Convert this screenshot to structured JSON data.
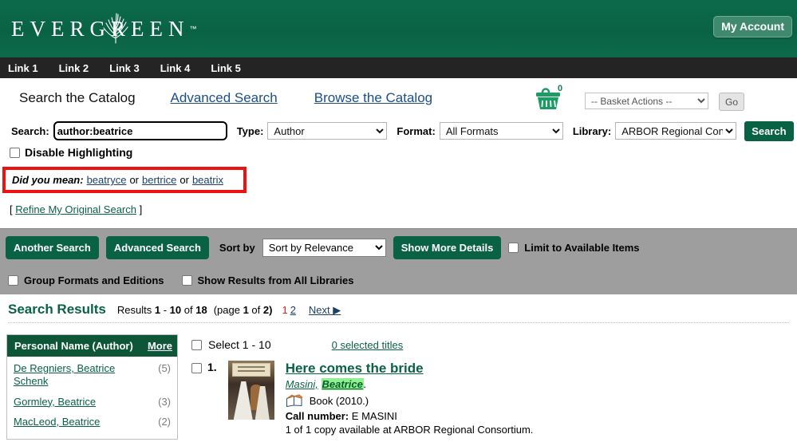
{
  "brand": {
    "logo_text": "EVERGREEN",
    "logo_tm": "™",
    "my_account_label": "My Account"
  },
  "linkbar": {
    "items": [
      {
        "label": "Link 1"
      },
      {
        "label": "Link 2"
      },
      {
        "label": "Link 3"
      },
      {
        "label": "Link 4"
      },
      {
        "label": "Link 5"
      }
    ]
  },
  "catalog_bar": {
    "search_catalog_label": "Search the Catalog",
    "advanced_search_label": "Advanced Search",
    "browse_catalog_label": "Browse the Catalog",
    "basket_count": "0",
    "basket_actions_value": "-- Basket Actions --",
    "go_label": "Go"
  },
  "search_form": {
    "search_label": "Search:",
    "search_value": "author:beatrice",
    "type_label": "Type:",
    "type_value": "Author",
    "format_label": "Format:",
    "format_value": "All Formats",
    "library_label": "Library:",
    "library_value": "ARBOR Regional Consortium",
    "search_button_label": "Search",
    "disable_highlighting_label": "Disable Highlighting"
  },
  "did_you_mean": {
    "label": "Did you mean:",
    "suggestions": [
      {
        "term": "beatryce"
      },
      {
        "term": "bertrice"
      },
      {
        "term": "beatrix"
      }
    ],
    "separator": "or",
    "highlight_color": "#ee1111"
  },
  "refine": {
    "open_bracket": "[",
    "link_label": "Refine My Original Search",
    "close_bracket": "]"
  },
  "toolbar": {
    "another_search_label": "Another Search",
    "advanced_search_label": "Advanced Search",
    "sort_by_label": "Sort by",
    "sort_value": "Sort by Relevance",
    "show_more_details_label": "Show More Details",
    "limit_available_label": "Limit to Available Items",
    "group_formats_label": "Group Formats and Editions",
    "show_all_libraries_label": "Show Results from All Libraries"
  },
  "results_header": {
    "title": "Search Results",
    "results_word": "Results",
    "range_start": "1",
    "range_dash": "-",
    "range_end": "10",
    "of_word": "of",
    "total": "18",
    "page_open": "(page",
    "page_current": "1",
    "page_of": "of",
    "page_total": "2)",
    "page_link_current": "1",
    "page_link_other": "2",
    "next_label": "Next ▶"
  },
  "facets": {
    "title": "Personal Name (Author)",
    "more_label": "More",
    "items": [
      {
        "label": "De Regniers, Beatrice Schenk",
        "count": "(5)"
      },
      {
        "label": "Gormley, Beatrice",
        "count": "(3)"
      },
      {
        "label": "MacLeod, Beatrice",
        "count": "(2)"
      }
    ]
  },
  "results_list": {
    "select_all_label": "Select 1 - 10",
    "selected_titles_label": "0 selected titles",
    "items": [
      {
        "number": "1.",
        "title": "Here comes the bride",
        "author_prefix": "Masini,",
        "author_highlight": "Beatrice",
        "author_suffix": ".",
        "format": "Book (2010.)",
        "call_number_label": "Call number:",
        "call_number": "E MASINI",
        "availability": "1 of 1 copy available at ARBOR Regional Consortium."
      }
    ]
  },
  "colors": {
    "brand_green": "#0a6245",
    "dark_green": "#0d5638",
    "link_blue": "#1a3f6e",
    "nav_dark": "#242424",
    "toolbar_gray": "#9e9e9e",
    "annotation_red": "#ee1111",
    "highlight_green": "#8ef08e",
    "page_current_red": "#d61c1c"
  }
}
